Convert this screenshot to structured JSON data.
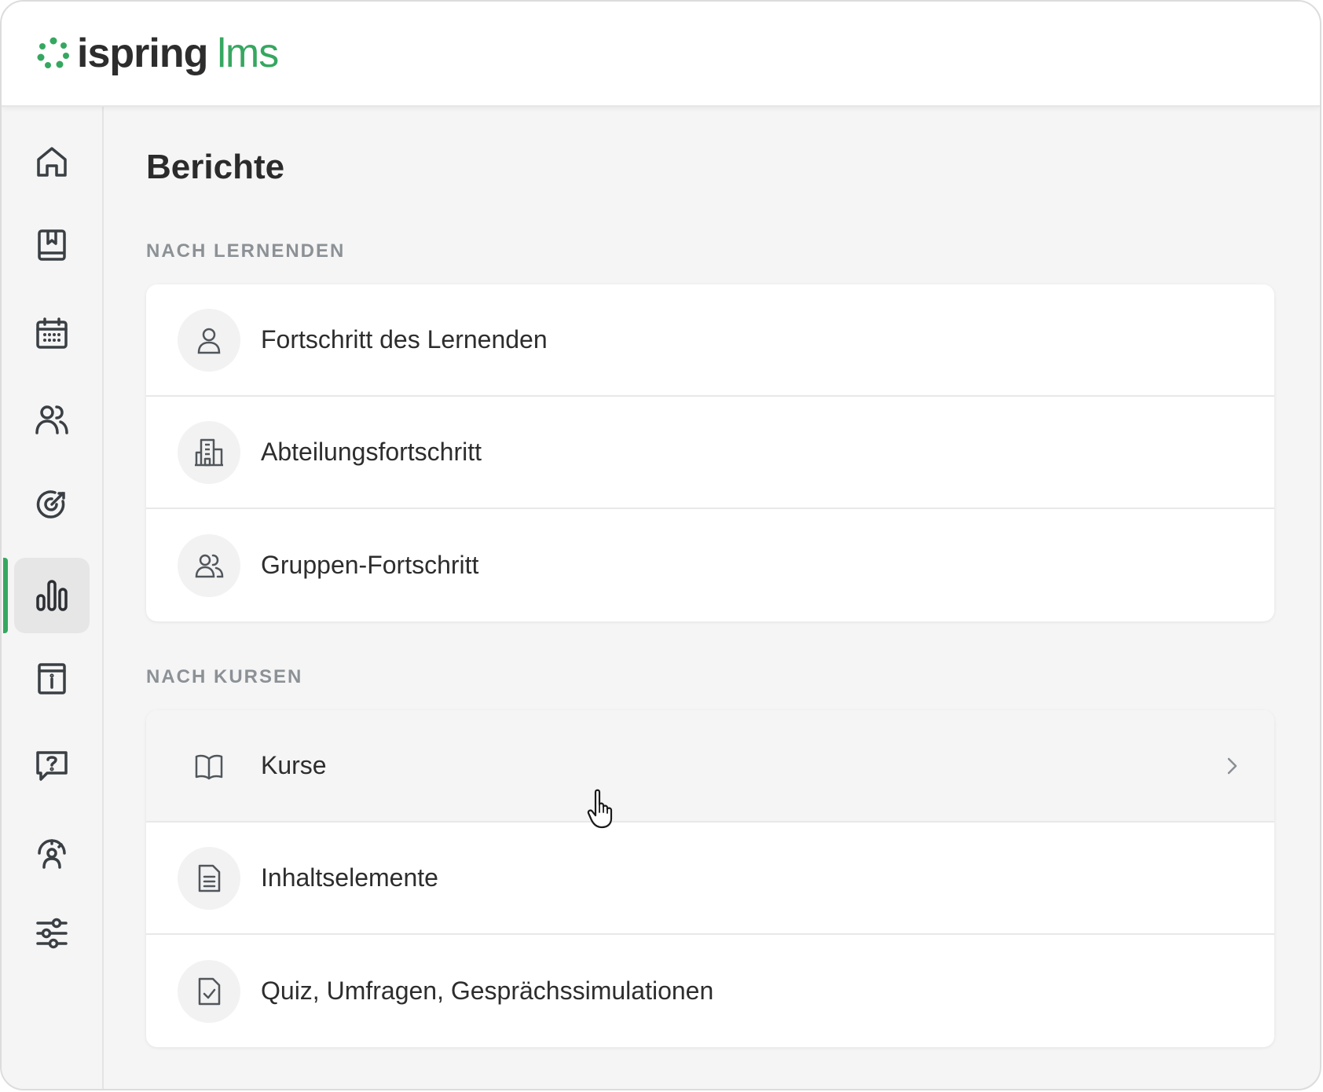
{
  "app": {
    "logo_primary": "ispring",
    "logo_secondary": "lms",
    "brand_color": "#36a760"
  },
  "sidebar": {
    "items": [
      {
        "name": "home-icon",
        "active": false
      },
      {
        "name": "book-bookmark-icon",
        "active": false
      },
      {
        "name": "calendar-icon",
        "active": false
      },
      {
        "name": "users-icon",
        "active": false
      },
      {
        "name": "target-icon",
        "active": false
      },
      {
        "name": "bar-chart-icon",
        "active": true
      },
      {
        "name": "info-calendar-icon",
        "active": false
      },
      {
        "name": "question-chat-icon",
        "active": false
      },
      {
        "name": "user-gauge-icon",
        "active": false
      },
      {
        "name": "sliders-icon",
        "active": false
      }
    ]
  },
  "main": {
    "title": "Berichte",
    "sections": [
      {
        "label": "NACH LERNENDEN",
        "items": [
          {
            "label": "Fortschritt des Lernenden",
            "icon": "user-icon"
          },
          {
            "label": "Abteilungsfortschritt",
            "icon": "building-icon"
          },
          {
            "label": "Gruppen-Fortschritt",
            "icon": "group-icon"
          }
        ]
      },
      {
        "label": "NACH KURSEN",
        "items": [
          {
            "label": "Kurse",
            "icon": "open-book-icon",
            "hovered": true
          },
          {
            "label": "Inhaltselemente",
            "icon": "document-icon"
          },
          {
            "label": "Quiz, Umfragen, Gesprächssimulationen",
            "icon": "checklist-icon"
          }
        ]
      }
    ]
  }
}
